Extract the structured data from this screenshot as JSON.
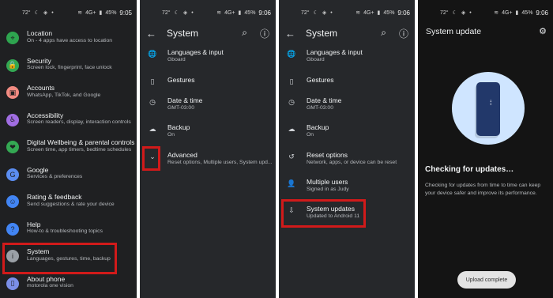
{
  "panel1": {
    "status": {
      "left": "72°",
      "time": "9:05",
      "battery": "45%",
      "network": "4G+"
    },
    "items": [
      {
        "title": "Location",
        "subtitle": "On - 4 apps have access to location",
        "icon": "location-icon",
        "color": "#2ea44f",
        "glyph": "⌖"
      },
      {
        "title": "Security",
        "subtitle": "Screen lock, fingerprint, face unlock",
        "icon": "lock-icon",
        "color": "#34a853",
        "glyph": "🔒"
      },
      {
        "title": "Accounts",
        "subtitle": "WhatsApp, TikTok, and Google",
        "icon": "accounts-icon",
        "color": "#f28b82",
        "glyph": "▣"
      },
      {
        "title": "Accessibility",
        "subtitle": "Screen readers, display, interaction controls",
        "icon": "accessibility-icon",
        "color": "#a06de2",
        "glyph": "♿"
      },
      {
        "title": "Digital Wellbeing & parental controls",
        "subtitle": "Screen time, app timers, bedtime schedules",
        "icon": "wellbeing-icon",
        "color": "#34a853",
        "glyph": "❤"
      },
      {
        "title": "Google",
        "subtitle": "Services & preferences",
        "icon": "google-icon",
        "color": "#5b8df0",
        "glyph": "G"
      },
      {
        "title": "Rating & feedback",
        "subtitle": "Send suggestions & rate your device",
        "icon": "rating-icon",
        "color": "#4285f4",
        "glyph": "☺"
      },
      {
        "title": "Help",
        "subtitle": "How-to & troubleshooting topics",
        "icon": "help-icon",
        "color": "#4285f4",
        "glyph": "?"
      },
      {
        "title": "System",
        "subtitle": "Languages, gestures, time, backup",
        "icon": "info-icon",
        "color": "#9aa0a6",
        "glyph": "i"
      },
      {
        "title": "About phone",
        "subtitle": "motorola one vision",
        "icon": "phone-icon",
        "color": "#7b8fe8",
        "glyph": "▯"
      }
    ]
  },
  "panel2": {
    "status": {
      "left": "72°",
      "time": "9:06",
      "battery": "45%",
      "network": "4G+"
    },
    "title": "System",
    "items": [
      {
        "title": "Languages & input",
        "subtitle": "Gboard",
        "icon": "globe-icon",
        "glyph": "🌐"
      },
      {
        "title": "Gestures",
        "subtitle": "",
        "icon": "gestures-icon",
        "glyph": "▯"
      },
      {
        "title": "Date & time",
        "subtitle": "GMT-03:00",
        "icon": "clock-icon",
        "glyph": "◷"
      },
      {
        "title": "Backup",
        "subtitle": "On",
        "icon": "cloud-backup-icon",
        "glyph": "☁"
      },
      {
        "title": "Advanced",
        "subtitle": "Reset options, Multiple users, System upd...",
        "icon": "chevron-down-icon",
        "glyph": "⌄"
      }
    ]
  },
  "panel3": {
    "status": {
      "left": "72°",
      "time": "9:06",
      "battery": "45%",
      "network": "4G+"
    },
    "title": "System",
    "items": [
      {
        "title": "Languages & input",
        "subtitle": "Gboard",
        "icon": "globe-icon",
        "glyph": "🌐"
      },
      {
        "title": "Gestures",
        "subtitle": "",
        "icon": "gestures-icon",
        "glyph": "▯"
      },
      {
        "title": "Date & time",
        "subtitle": "GMT-03:00",
        "icon": "clock-icon",
        "glyph": "◷"
      },
      {
        "title": "Backup",
        "subtitle": "On",
        "icon": "cloud-backup-icon",
        "glyph": "☁"
      },
      {
        "title": "Reset options",
        "subtitle": "Network, apps, or device can be reset",
        "icon": "history-icon",
        "glyph": "↺"
      },
      {
        "title": "Multiple users",
        "subtitle": "Signed in as Judy",
        "icon": "user-icon",
        "glyph": "👤"
      },
      {
        "title": "System updates",
        "subtitle": "Updated to Android 11",
        "icon": "system-update-icon",
        "glyph": "⇩"
      }
    ]
  },
  "panel4": {
    "status": {
      "left": "72°",
      "time": "9:06",
      "battery": "45%",
      "network": "4G+"
    },
    "title": "System update",
    "checking": "Checking for updates…",
    "description": "Checking for updates from time to time can keep your device safer and improve its performance.",
    "upload_button": "Upload complete"
  }
}
